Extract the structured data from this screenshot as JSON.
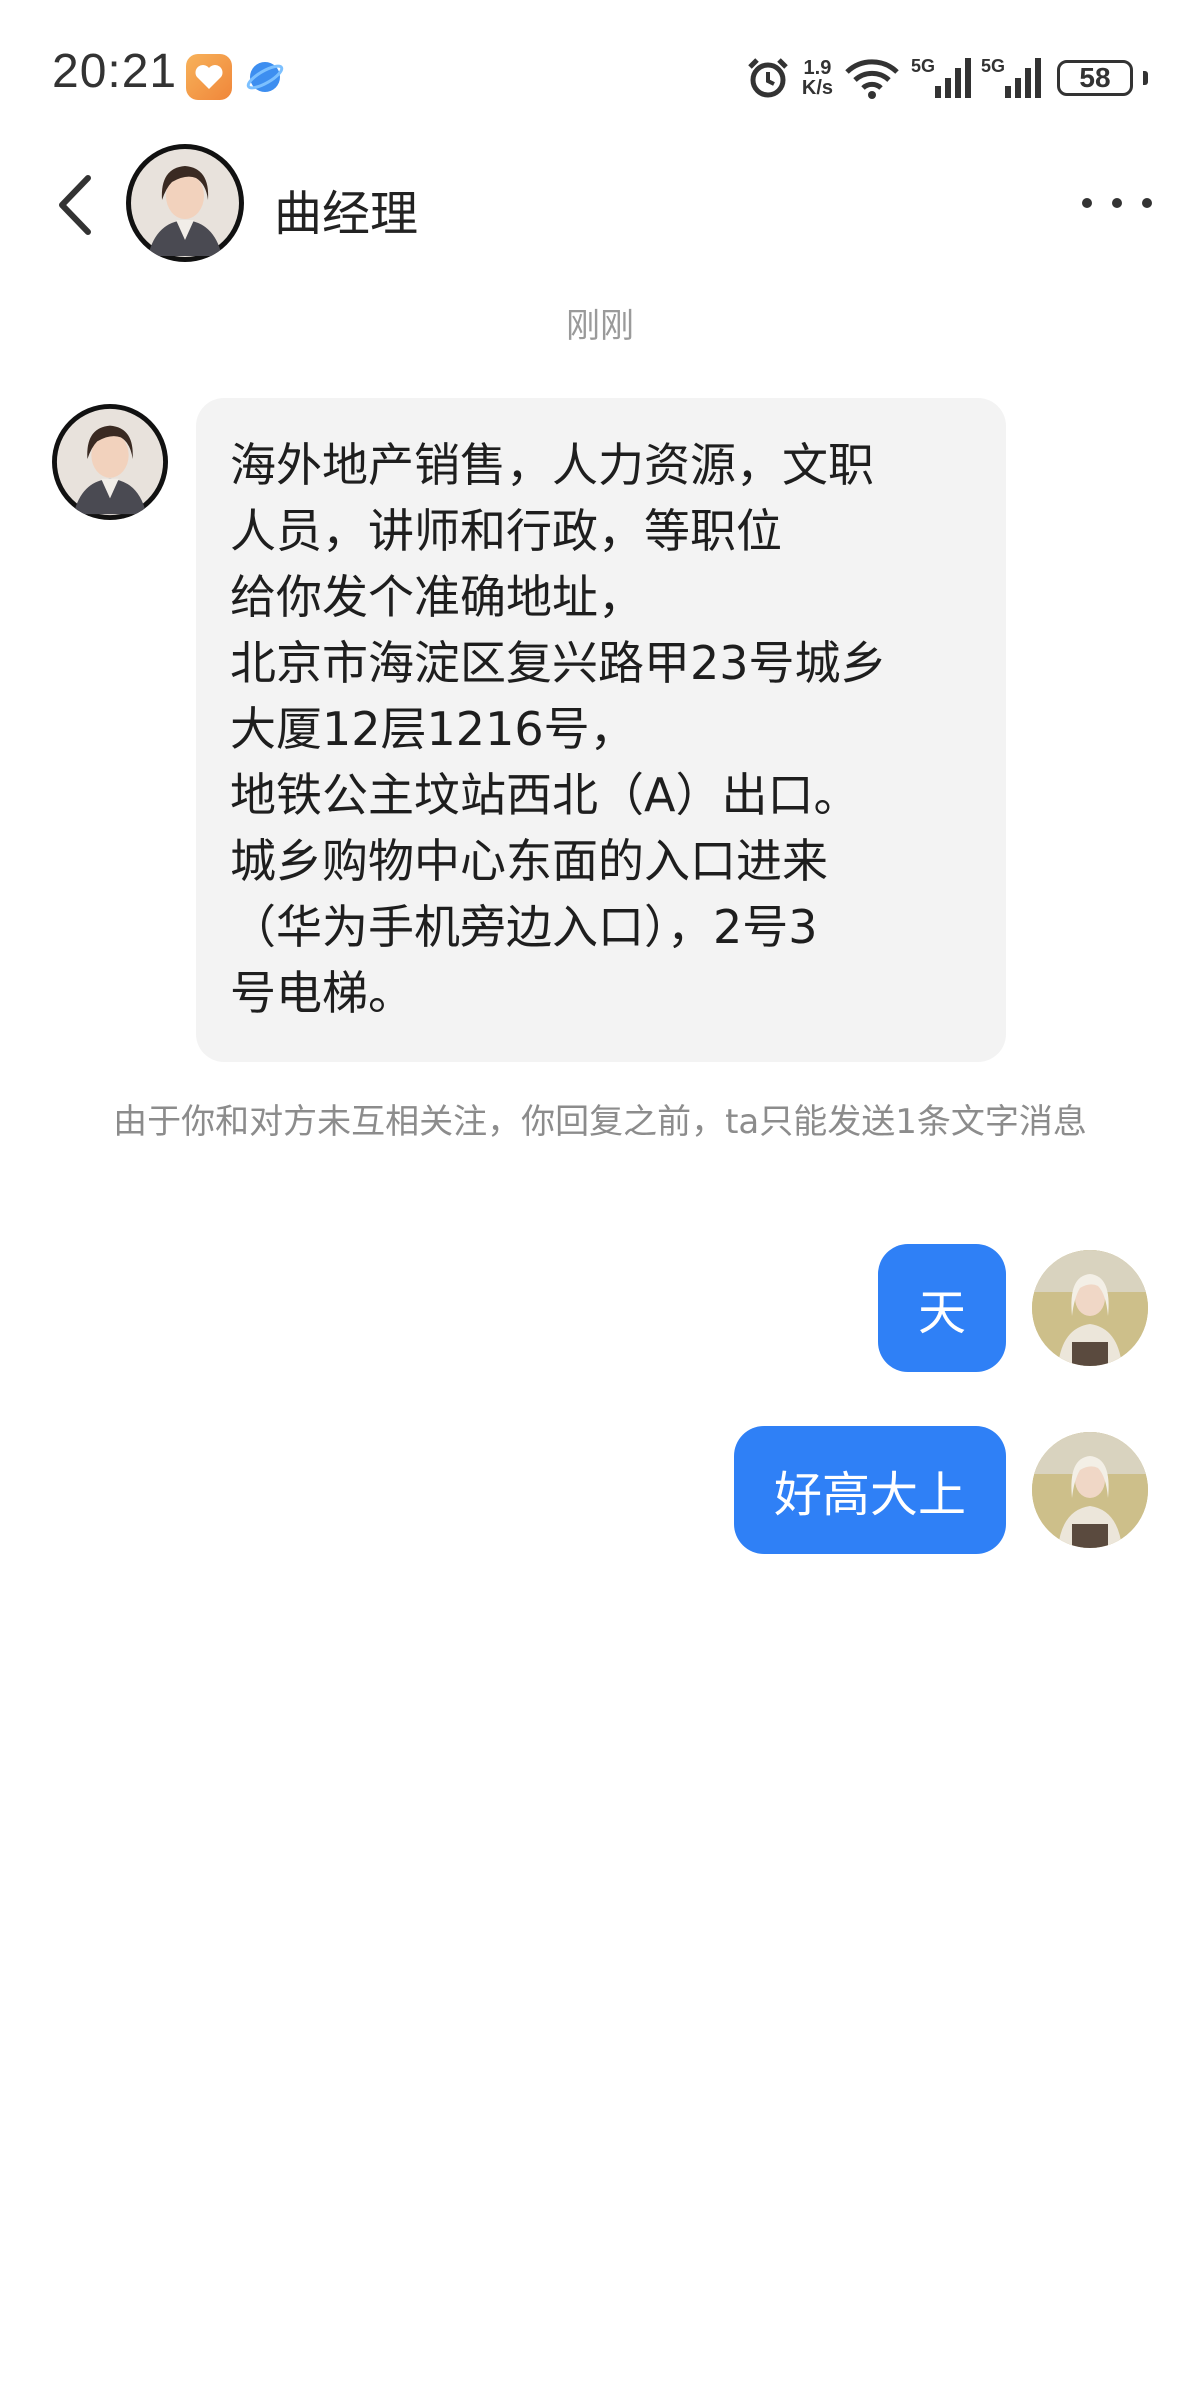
{
  "status_bar": {
    "time": "20:21",
    "net_speed_value": "1.9",
    "net_speed_unit": "K/s",
    "signal_1_label": "5G",
    "signal_2_label": "5G",
    "battery": "58"
  },
  "header": {
    "contact_name": "曲经理"
  },
  "conversation": {
    "timestamp": "刚刚",
    "incoming_lines": [
      "海外地产销售，人力资源，文职",
      "人员，讲师和行政，等职位",
      "给你发个准确地址，",
      "北京市海淀区复兴路甲23号城乡",
      "大厦12层1216号，",
      "地铁公主坟站西北（A）出口。",
      "城乡购物中心东面的入口进来",
      "（华为手机旁边入口），2号3",
      "号电梯。"
    ],
    "notice": "由于你和对方未互相关注，你回复之前，ta只能发送1条文字消息",
    "outgoing": [
      {
        "text": "天"
      },
      {
        "text": "好高大上"
      }
    ]
  },
  "colors": {
    "outgoing_bubble": "#2f80f6",
    "incoming_bubble": "#f3f3f3",
    "timestamp_text": "#9a9a9a"
  }
}
